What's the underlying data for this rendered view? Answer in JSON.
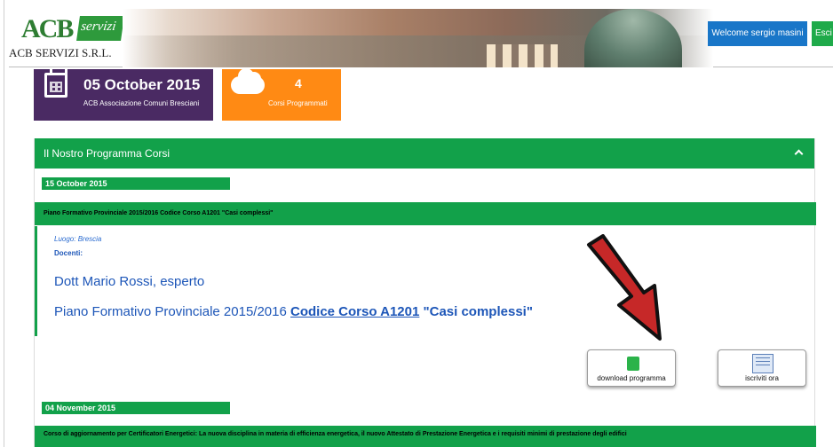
{
  "header": {
    "logo_main": "ACB",
    "logo_badge": "servizi",
    "company": "ACB SERVIZI S.R.L.",
    "welcome_button": "Welcome sergio masini",
    "exit_button": "Esci"
  },
  "tiles": {
    "date": {
      "value": "05 October 2015",
      "subtitle": "ACB Associazione Comuni Bresciani",
      "icon": "calendar-icon",
      "color": "#4a2a63"
    },
    "courses": {
      "value": "4",
      "subtitle": "Corsi Programmati",
      "icon": "cloud-icon",
      "color": "#ff8a14"
    }
  },
  "panel": {
    "title": "Il Nostro Programma Corsi",
    "accent": "#12a14a",
    "entries": [
      {
        "date": "15 October 2015",
        "title": "Piano Formativo Provinciale 2015/2016 Codice Corso A1201 \"Casi complessi\"",
        "luogo": "Luogo: Brescia",
        "docenti_label": "Docenti:",
        "docente": "Dott Mario Rossi, esperto",
        "course_prefix": "Piano Formativo Provinciale 2015/2016",
        "course_code": "Codice Corso A1201",
        "course_quote": "\"Casi complessi\"",
        "download_label": "download programma",
        "enroll_label": "iscriviti ora"
      },
      {
        "date": "04 November 2015",
        "title": "Corso di aggiornamento per Certificatori Energetici: La nuova disciplina in materia di efficienza energetica, il nuovo Attestato di Prestazione Energetica e i requisiti minimi di prestazione degli edifici"
      }
    ]
  },
  "annotation": {
    "arrow_color": "#c62828"
  }
}
